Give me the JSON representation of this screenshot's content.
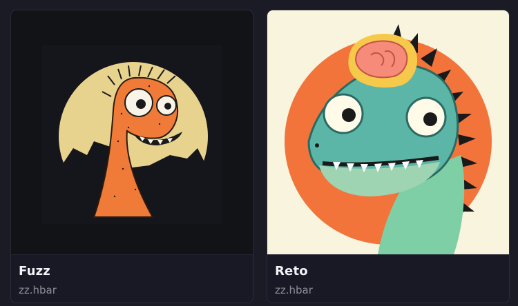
{
  "cards": [
    {
      "name": "Fuzz",
      "owner": "zz.hbar",
      "colors": {
        "background": "#121317",
        "disc": "#e8d38e",
        "creature": "#f07a37"
      }
    },
    {
      "name": "Reto",
      "owner": "zz.hbar",
      "colors": {
        "background": "#f8f4de",
        "disc": "#f2743b",
        "creature": "#5cb6a8",
        "brain": "#f58b78"
      }
    }
  ]
}
